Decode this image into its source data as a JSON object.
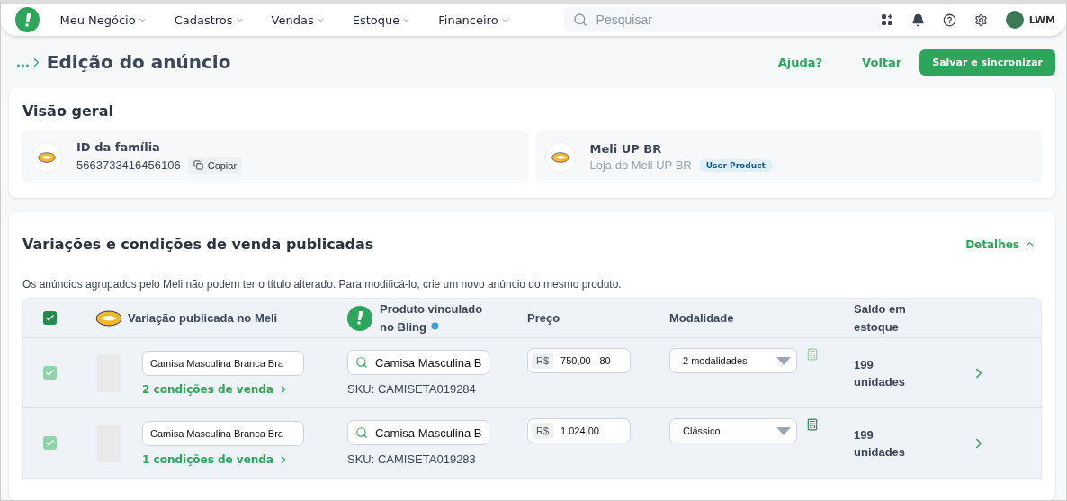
{
  "nav": {
    "menus": [
      "Meu Negócio",
      "Cadastros",
      "Vendas",
      "Estoque",
      "Financeiro"
    ],
    "search": {
      "placeholder": "Pesquisar"
    },
    "user": "LWM"
  },
  "header": {
    "breadcrumb": "...",
    "title": "Edição do anúncio",
    "help": "Ajuda?",
    "back": "Voltar",
    "save": "Salvar e sincronizar"
  },
  "overview": {
    "title": "Visão geral",
    "family": {
      "label": "ID da família",
      "id": "5663733416456106",
      "copy": "Copiar"
    },
    "store": {
      "name": "Meli UP BR",
      "subtitle": "Loja do Meli UP BR",
      "badge": "User Product"
    }
  },
  "variations": {
    "title": "Variações e condições de venda publicadas",
    "details": "Detalhes",
    "expanded": true,
    "note": "Os anúncios agrupados pelo Meli não podem ter o título alterado. Para modificá-lo, crie um novo anúncio do mesmo produto.",
    "header_checked": true,
    "columns": [
      "Variação publicada no Meli",
      "Produto vinculado no Bling",
      "Preço",
      "Modalidade",
      "Saldo em estoque"
    ],
    "rows": [
      {
        "checked": true,
        "disabled": true,
        "title": "Camisa Masculina Branca Bra",
        "conditions": "2 condições de venda",
        "product": "Camisa Masculina B",
        "sku": "SKU: CAMISETA019284",
        "currency": "R$",
        "price": "750,00 - 80",
        "modality": "2 modalidades",
        "calculator_active": false,
        "stock": "199 unidades"
      },
      {
        "checked": true,
        "disabled": true,
        "title": "Camisa Masculina Branca Bra",
        "conditions": "1 condições de venda",
        "product": "Camisa Masculina B",
        "sku": "SKU: CAMISETA019283",
        "currency": "R$",
        "price": "1.024,00",
        "modality": "Clássico",
        "calculator_active": true,
        "stock": "199 unidades"
      }
    ]
  }
}
